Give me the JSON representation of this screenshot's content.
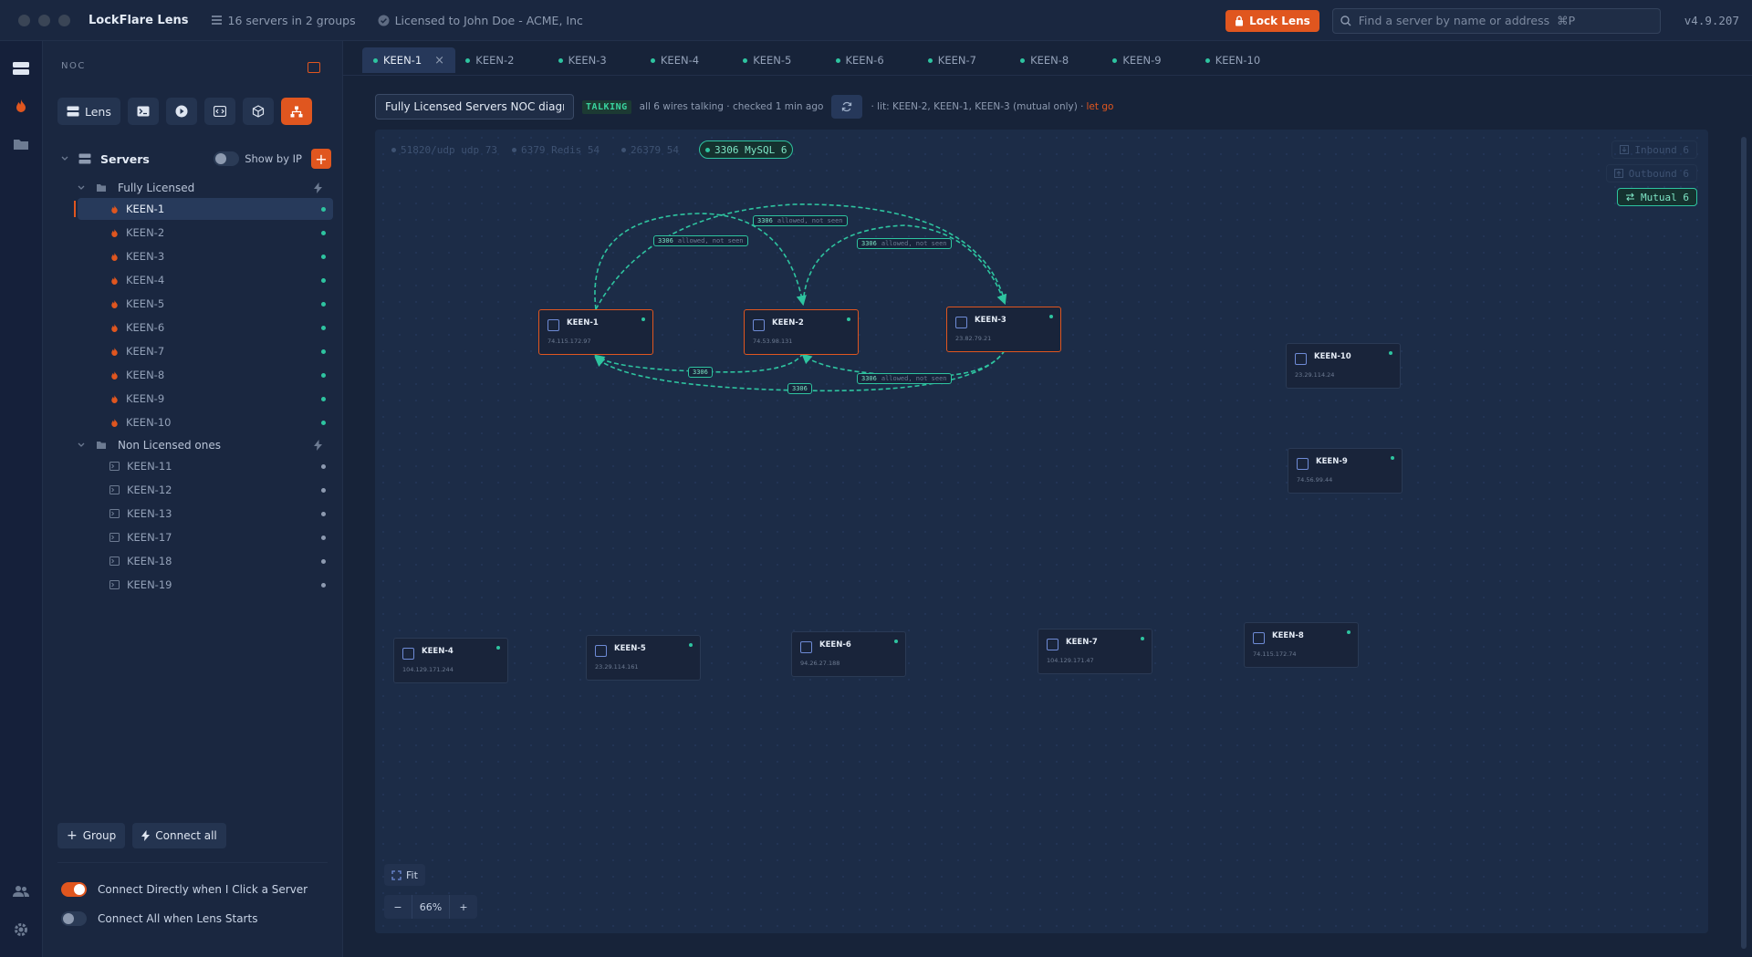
{
  "app": {
    "title": "LockFlare Lens",
    "servers_meta": "16 servers in 2 groups",
    "license_meta": "Licensed to John Doe - ACME, Inc",
    "lock_label": "Lock Lens",
    "search_placeholder": "Find a server by name or address  ⌘P",
    "version": "v4.9.207"
  },
  "sidebar": {
    "heading": "NOC",
    "modes": [
      {
        "label": "Lens",
        "icon": "servers-icon"
      },
      {
        "label": "",
        "icon": "terminal-icon"
      },
      {
        "label": "",
        "icon": "play-icon"
      },
      {
        "label": "",
        "icon": "code-icon"
      },
      {
        "label": "",
        "icon": "cube-icon"
      },
      {
        "label": "",
        "icon": "diagram-icon"
      }
    ],
    "servers_title": "Servers",
    "show_by_ip_label": "Show by IP",
    "groups": [
      {
        "name": "Fully Licensed",
        "servers": [
          "KEEN-1",
          "KEEN-2",
          "KEEN-3",
          "KEEN-4",
          "KEEN-5",
          "KEEN-6",
          "KEEN-7",
          "KEEN-8",
          "KEEN-9",
          "KEEN-10"
        ]
      },
      {
        "name": "Non Licensed ones",
        "servers": [
          "KEEN-11",
          "KEEN-12",
          "KEEN-13",
          "KEEN-17",
          "KEEN-18",
          "KEEN-19"
        ]
      }
    ],
    "selected_server": "KEEN-1",
    "group_button": "Group",
    "connect_all_button": "Connect all",
    "options": [
      {
        "label": "Connect Directly when I Click a Server",
        "on": true
      },
      {
        "label": "Connect All when Lens Starts",
        "on": false
      }
    ]
  },
  "tabs": [
    "KEEN-1",
    "KEEN-2",
    "KEEN-3",
    "KEEN-4",
    "KEEN-5",
    "KEEN-6",
    "KEEN-7",
    "KEEN-8",
    "KEEN-9",
    "KEEN-10"
  ],
  "active_tab": "KEEN-1",
  "diagram": {
    "name": "Fully Licensed Servers NOC diagram",
    "status_badge": "TALKING",
    "status_message": "all 6 wires talking · checked 1 min ago",
    "lit_message": "· lit: KEEN-2, KEEN-1, KEEN-3 (mutual only) ·",
    "let_go": "let go",
    "port_chips": [
      {
        "label": "51820/udp udp 73",
        "active": false
      },
      {
        "label": "6379 Redis 54",
        "active": false
      },
      {
        "label": "26379 54",
        "active": false
      },
      {
        "label": "3306 MySQL 6",
        "active": true
      }
    ],
    "direction_filters": [
      {
        "label": "Inbound 6",
        "active": false
      },
      {
        "label": "Outbound 6",
        "active": false
      },
      {
        "label": "Mutual 6",
        "active": true
      }
    ],
    "nodes": [
      {
        "name": "KEEN-1",
        "ip": "74.115.172.97",
        "licensed": true,
        "icon": "terminal-box-icon"
      },
      {
        "name": "KEEN-2",
        "ip": "74.53.98.131",
        "licensed": true,
        "icon": "terminal-box-icon"
      },
      {
        "name": "KEEN-3",
        "ip": "23.82.79.21",
        "licensed": true,
        "icon": "terminal-box-icon"
      },
      {
        "name": "KEEN-10",
        "ip": "23.29.114.24",
        "licensed": false,
        "icon": "code-braces-icon"
      },
      {
        "name": "KEEN-9",
        "ip": "74.56.99.44",
        "licensed": false,
        "icon": "server-stack-icon"
      },
      {
        "name": "KEEN-4",
        "ip": "104.129.171.244",
        "licensed": false,
        "icon": "terminal-box-icon"
      },
      {
        "name": "KEEN-5",
        "ip": "23.29.114.161",
        "licensed": false,
        "icon": "terminal-box-icon"
      },
      {
        "name": "KEEN-6",
        "ip": "94.26.27.188",
        "licensed": false,
        "icon": "terminal-box-icon"
      },
      {
        "name": "KEEN-7",
        "ip": "104.129.171.47",
        "licensed": false,
        "icon": "terminal-box-icon"
      },
      {
        "name": "KEEN-8",
        "ip": "74.115.172.74",
        "licensed": false,
        "icon": "server-stack-icon"
      }
    ],
    "wires": [
      {
        "port": "3306",
        "note": "allowed, not seen"
      },
      {
        "port": "3306",
        "note": "allowed, not seen"
      },
      {
        "port": "3306",
        "note": "allowed, not seen"
      },
      {
        "port": "3306",
        "note": ""
      },
      {
        "port": "3306",
        "note": "allowed, not seen"
      },
      {
        "port": "3306",
        "note": ""
      }
    ],
    "fit_label": "Fit",
    "zoom": "66%"
  },
  "colors": {
    "accent": "#e0561f",
    "online": "#2ec4a0",
    "offline": "#8d9ab0"
  }
}
